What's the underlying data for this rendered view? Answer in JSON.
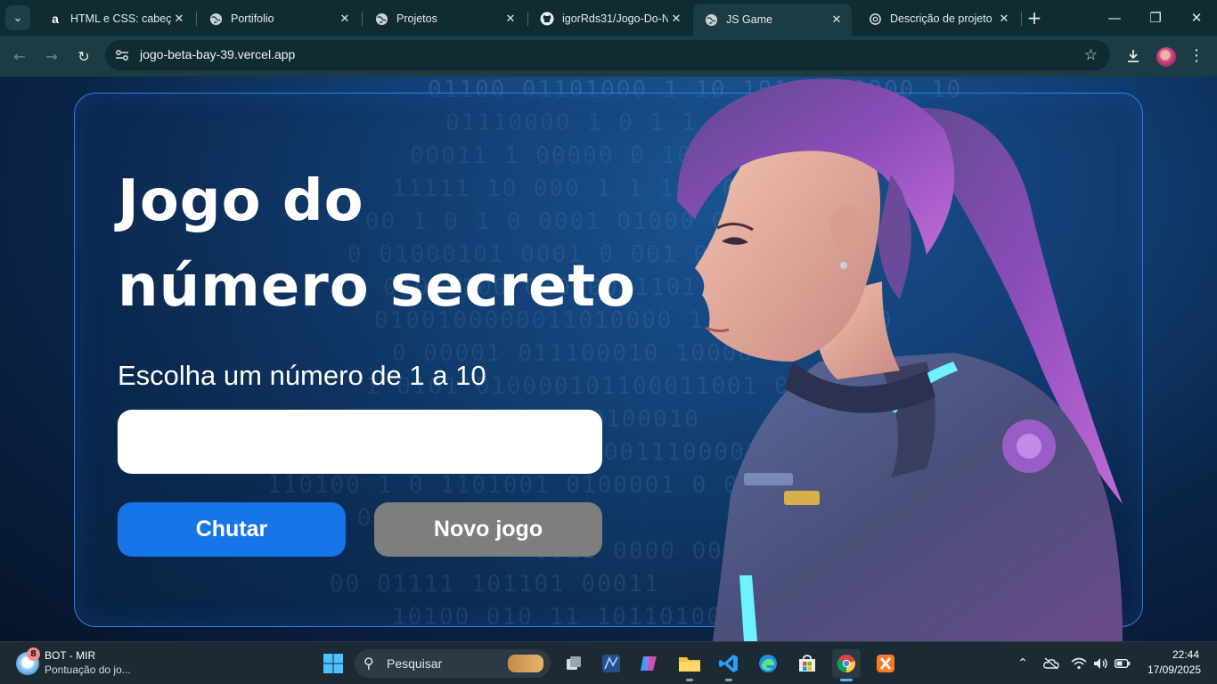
{
  "browser": {
    "tabs": [
      {
        "title": "HTML e CSS: cabeçalho",
        "icon": "alura-icon",
        "active": false
      },
      {
        "title": "Portifolio",
        "icon": "globe-icon",
        "active": false
      },
      {
        "title": "Projetos",
        "icon": "globe-icon",
        "active": false
      },
      {
        "title": "igorRds31/Jogo-Do-N",
        "icon": "github-icon",
        "active": false
      },
      {
        "title": "JS Game",
        "icon": "globe-icon",
        "active": true
      },
      {
        "title": "Descrição de projeto",
        "icon": "openai-icon",
        "active": false
      }
    ],
    "url": "jogo-beta-bay-39.vercel.app"
  },
  "game": {
    "title_line1": "Jogo do",
    "title_line2": "número secreto",
    "subtitle": "Escolha um número de 1 a 10",
    "input_value": "",
    "guess_button": "Chutar",
    "new_game_button": "Novo jogo"
  },
  "background": {
    "binary_rows": [
      "01100 01101000 1     10   10101000000 10",
      "01110000    1 0     1   1 0",
      "00011 1 00000         0 10 001 000100000 010",
      "11111 10       000      1   1 1 0  0",
      "00 1 0 1 0 0001 01000        0 001011",
      "0   01000101 0001 0      001 0  0",
      "01010100 01000011101 0",
      "0100100000011010000        1 01000011 00",
      "0 00001 011100010  10000 1",
      "1 0101 010000101100011001 0",
      "1 1 000 1 0000110100010",
      "00 11 00010 1 01 1001110000101",
      "110100 1 0 1101001 0100001 0    0 11 100",
      "1    0 01101 01101",
      "0011 0000 00010",
      "00 01111  101101 00011",
      "10100 010 11 10110100 1011001010 010 0"
    ],
    "accent_color": "#1875e8",
    "secondary_color": "#7e7e7e",
    "border_color": "#2f7fe0"
  },
  "taskbar": {
    "widget_badge": "8",
    "widget_title": "BOT - MIR",
    "widget_subtitle": "Pontuação do jo...",
    "search_placeholder": "Pesquisar",
    "time": "22:44",
    "date": "17/09/2025"
  }
}
